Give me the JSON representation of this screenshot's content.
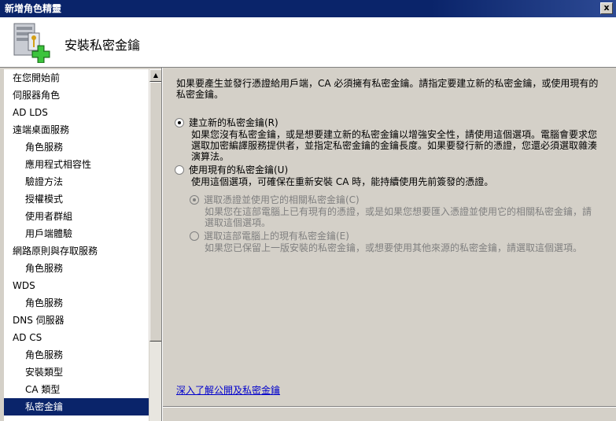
{
  "window": {
    "title": "新增角色精靈",
    "close_glyph": "x"
  },
  "header": {
    "title": "安裝私密金鑰",
    "icon": "server-key-add-icon"
  },
  "nav": {
    "items": [
      {
        "label": "在您開始前",
        "level": 0,
        "active": false
      },
      {
        "label": "伺服器角色",
        "level": 0,
        "active": false
      },
      {
        "label": "AD LDS",
        "level": 0,
        "active": false
      },
      {
        "label": "遠端桌面服務",
        "level": 0,
        "active": false
      },
      {
        "label": "角色服務",
        "level": 1,
        "active": false
      },
      {
        "label": "應用程式相容性",
        "level": 1,
        "active": false
      },
      {
        "label": "驗證方法",
        "level": 1,
        "active": false
      },
      {
        "label": "授權模式",
        "level": 1,
        "active": false
      },
      {
        "label": "使用者群組",
        "level": 1,
        "active": false
      },
      {
        "label": "用戶端體驗",
        "level": 1,
        "active": false
      },
      {
        "label": "網路原則與存取服務",
        "level": 0,
        "active": false
      },
      {
        "label": "角色服務",
        "level": 1,
        "active": false
      },
      {
        "label": "WDS",
        "level": 0,
        "active": false
      },
      {
        "label": "角色服務",
        "level": 1,
        "active": false
      },
      {
        "label": "DNS 伺服器",
        "level": 0,
        "active": false
      },
      {
        "label": "AD CS",
        "level": 0,
        "active": false
      },
      {
        "label": "角色服務",
        "level": 1,
        "active": false
      },
      {
        "label": "安裝類型",
        "level": 1,
        "active": false
      },
      {
        "label": "CA 類型",
        "level": 1,
        "active": false
      },
      {
        "label": "私密金鑰",
        "level": 1,
        "active": true
      }
    ]
  },
  "main": {
    "intro": "如果要產生並發行憑證給用戶端，CA 必須擁有私密金鑰。請指定要建立新的私密金鑰，或使用現有的私密金鑰。",
    "option_new": {
      "label": "建立新的私密金鑰(R)",
      "checked": true,
      "description": "如果您沒有私密金鑰，或是想要建立新的私密金鑰以增強安全性，請使用這個選項。電腦會要求您選取加密編譯服務提供者，並指定私密金鑰的金鑰長度。如果要發行新的憑證，您還必須選取雜湊演算法。"
    },
    "option_existing": {
      "label": "使用現有的私密金鑰(U)",
      "checked": false,
      "description": "使用這個選項，可確保在重新安裝 CA 時，能持續使用先前簽發的憑證。"
    },
    "sub_option_cert": {
      "label": "選取憑證並使用它的相關私密金鑰(C)",
      "checked": true,
      "enabled": false,
      "description": "如果您在這部電腦上已有現有的憑證，或是如果您想要匯入憑證並使用它的相關私密金鑰，請選取這個選項。"
    },
    "sub_option_key": {
      "label": "選取這部電腦上的現有私密金鑰(E)",
      "checked": false,
      "enabled": false,
      "description": "如果您已保留上一版安裝的私密金鑰，或想要使用其他來源的私密金鑰，請選取這個選項。"
    },
    "learn_more": "深入了解公開及私密金鑰"
  },
  "colors": {
    "title_bar": "#0a246a",
    "selection": "#0a246a",
    "link": "#0000cc",
    "disabled": "#808080"
  }
}
